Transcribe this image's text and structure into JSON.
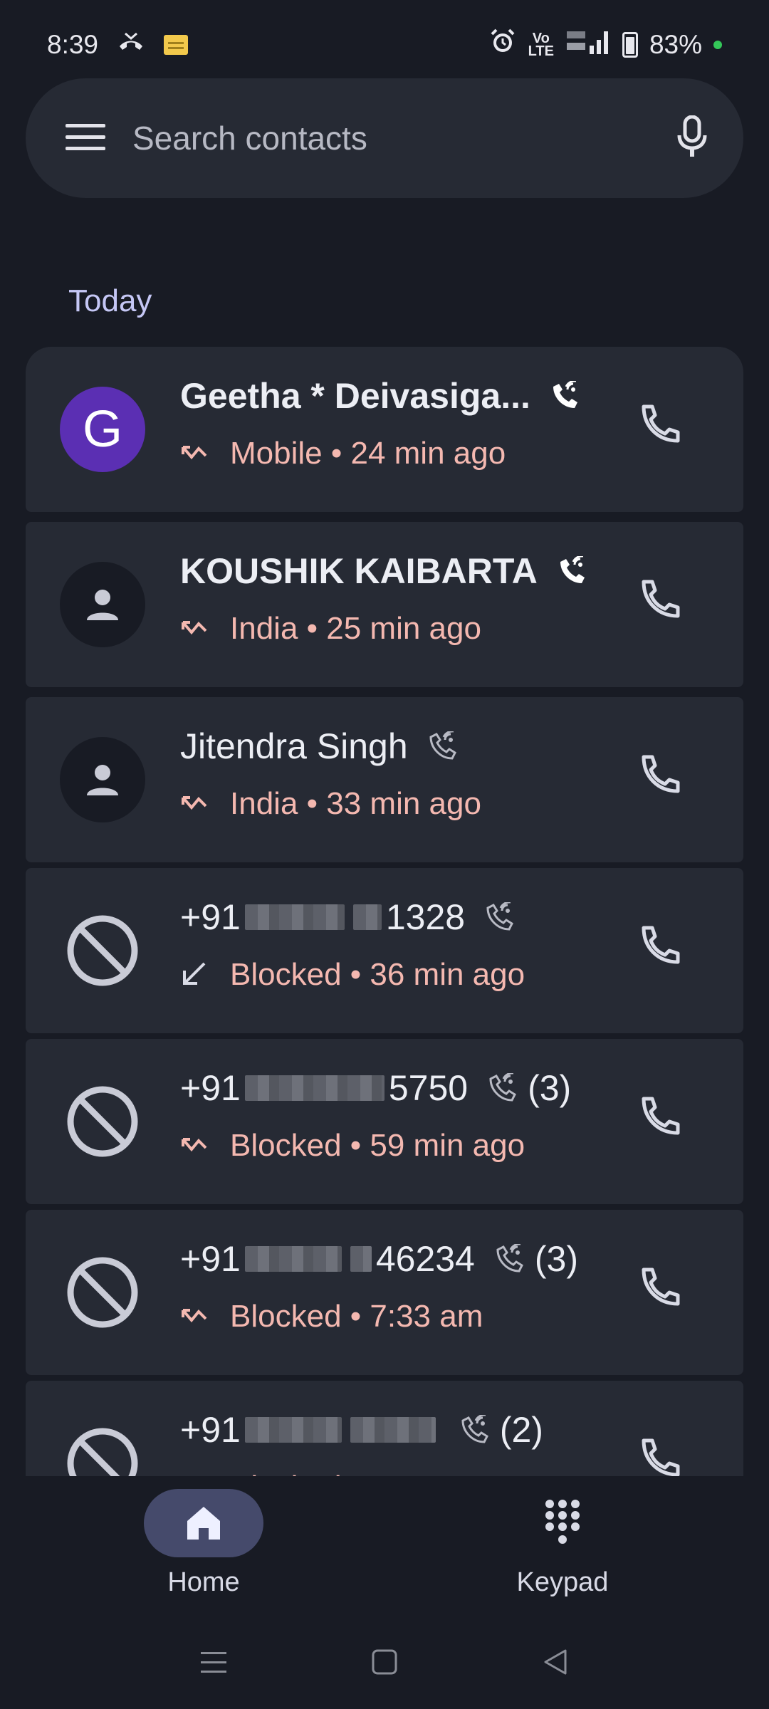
{
  "status": {
    "time": "8:39",
    "battery": "83%",
    "network": "Vo LTE"
  },
  "search": {
    "placeholder": "Search contacts"
  },
  "section": {
    "today": "Today"
  },
  "calls": [
    {
      "name": "Geetha * Deivasiga...",
      "avatar_letter": "G",
      "avatar": "letter",
      "bold": true,
      "direction": "missed",
      "detail": "Mobile • 24 min ago",
      "count": ""
    },
    {
      "name": "KOUSHIK KAIBARTA",
      "avatar": "person",
      "bold": true,
      "direction": "missed",
      "detail": "India • 25 min ago",
      "count": ""
    },
    {
      "name": "Jitendra Singh",
      "avatar": "person",
      "bold": false,
      "direction": "missed",
      "detail": "India • 33 min ago",
      "count": ""
    },
    {
      "name_prefix": "+91",
      "name_suffix": "1328",
      "avatar": "blocked",
      "direction": "incoming",
      "detail": "Blocked • 36 min ago",
      "count": ""
    },
    {
      "name_prefix": "+91",
      "name_suffix": "5750",
      "avatar": "blocked",
      "direction": "missed",
      "detail": "Blocked • 59 min ago",
      "count": "(3)"
    },
    {
      "name_prefix": "+91",
      "name_suffix": "46234",
      "avatar": "blocked",
      "direction": "missed",
      "detail": "Blocked • 7:33 am",
      "count": "(3)"
    },
    {
      "name_prefix": "+91",
      "name_suffix": "",
      "avatar": "blocked",
      "direction": "missed",
      "detail": "Blocked",
      "count": "(2)"
    }
  ],
  "nav": {
    "home": "Home",
    "keypad": "Keypad"
  },
  "colors": {
    "background": "#181b24",
    "card": "#262a34",
    "missed_text": "#f4b8b0",
    "accent": "#c5c7f5",
    "avatar_purple": "#5b2fb3"
  }
}
